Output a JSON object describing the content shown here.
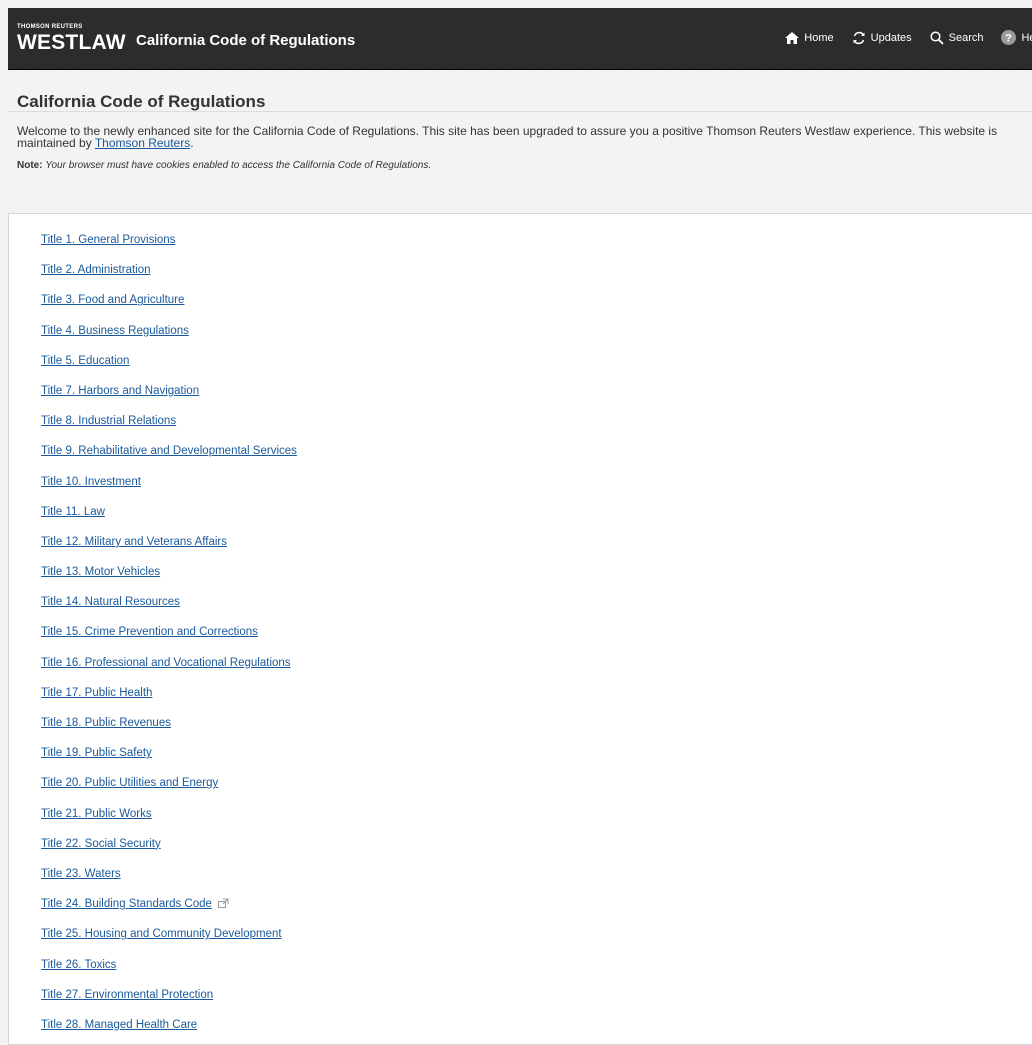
{
  "header": {
    "brand_small": "THOMSON REUTERS",
    "brand_big": "WESTLAW",
    "app_title": "California Code of Regulations",
    "nav": [
      {
        "label": "Home",
        "icon": "home-icon"
      },
      {
        "label": "Updates",
        "icon": "refresh-icon"
      },
      {
        "label": "Search",
        "icon": "search-icon"
      },
      {
        "label": "Hel",
        "icon": "help-icon"
      }
    ]
  },
  "page": {
    "title": "California Code of Regulations",
    "welcome_text": "Welcome to the newly enhanced site for the California Code of Regulations. This site has been upgraded to assure you a positive Thomson Reuters Westlaw experience. This website is maintained by ",
    "welcome_link": "Thomson Reuters",
    "welcome_end": ".",
    "note_label": "Note:",
    "note_text": "Your browser must have cookies enabled to access the California Code of Regulations."
  },
  "titles": [
    "Title 1. General Provisions",
    "Title 2. Administration",
    "Title 3. Food and Agriculture",
    "Title 4. Business Regulations",
    "Title 5. Education",
    "Title 7. Harbors and Navigation",
    "Title 8. Industrial Relations",
    "Title 9. Rehabilitative and Developmental Services",
    "Title 10. Investment",
    "Title 11. Law",
    "Title 12. Military and Veterans Affairs",
    "Title 13. Motor Vehicles",
    "Title 14. Natural Resources",
    "Title 15. Crime Prevention and Corrections",
    "Title 16. Professional and Vocational Regulations",
    "Title 17. Public Health",
    "Title 18. Public Revenues",
    "Title 19. Public Safety",
    "Title 20. Public Utilities and Energy",
    "Title 21. Public Works",
    "Title 22. Social Security",
    "Title 23. Waters",
    "Title 24. Building Standards Code",
    "Title 25. Housing and Community Development",
    "Title 26. Toxics",
    "Title 27. Environmental Protection",
    "Title 28. Managed Health Care"
  ],
  "external_link_icon": "external-link-icon",
  "colors": {
    "header_bg": "#2b2b2b",
    "link": "#1a5a9b",
    "page_bg": "#f3f3f3"
  }
}
